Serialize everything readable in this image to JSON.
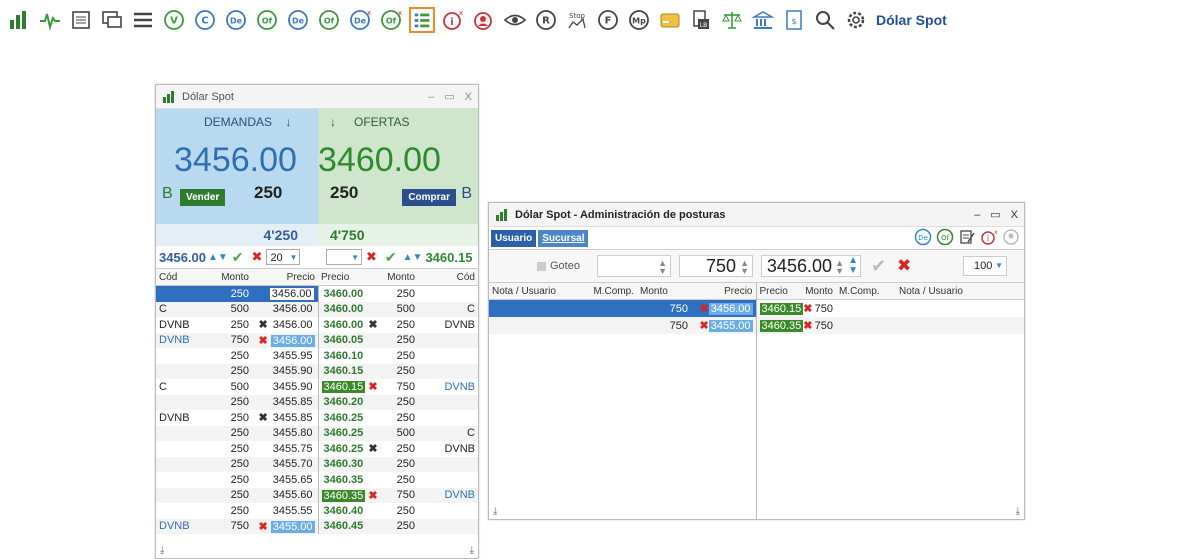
{
  "toolbar": {
    "title": "Dólar Spot",
    "icons": [
      "logo-icon",
      "chart-pulse-icon",
      "list-icon",
      "chat-icon",
      "menu-icon",
      "v-circle-icon",
      "c-circle-icon",
      "de-circle-icon",
      "of-circle-icon",
      "de-refresh-icon",
      "of-refresh-icon",
      "de-x-icon",
      "of-x-icon",
      "posturas-grid-icon",
      "info-x-icon",
      "users-x-icon",
      "eye-icon",
      "r-circle-icon",
      "stop-icon",
      "f-circle-icon",
      "mp-circle-icon",
      "card-icon",
      "lb-icon",
      "scale-icon",
      "bank-chart-icon",
      "document-icon",
      "search-icon",
      "gear-icon"
    ]
  },
  "book_window": {
    "title": "Dólar Spot",
    "demandas_label": "DEMANDAS",
    "ofertas_label": "OFERTAS",
    "best_bid": "3456.00",
    "best_ask": "3460.00",
    "bid_side_letter": "B",
    "ask_side_letter": "B",
    "vender_label": "Vender",
    "comprar_label": "Comprar",
    "bid_qty": "250",
    "ask_qty": "250",
    "bid_total": "4'250",
    "ask_total": "4'750",
    "bid_input_price": "3456.00",
    "bid_input_qty": "20",
    "ask_input_price": "3460.15",
    "columns": [
      "Cód",
      "Monto",
      "Precio",
      "Precio",
      "Monto",
      "Cód"
    ],
    "rows": [
      {
        "bcod": "",
        "bmonto": "250",
        "bprecio": "3456.00",
        "bx": "",
        "aprecio": "3460.00",
        "ax": "",
        "amonto": "250",
        "acod": ""
      },
      {
        "bcod": "C",
        "bmonto": "500",
        "bprecio": "3456.00",
        "bx": "",
        "aprecio": "3460.00",
        "ax": "",
        "amonto": "500",
        "acod": "C"
      },
      {
        "bcod": "DVNB",
        "bmonto": "250",
        "bprecio": "3456.00",
        "bx": "✖",
        "aprecio": "3460.00",
        "ax": "✖",
        "amonto": "250",
        "acod": "DVNB"
      },
      {
        "bcod": "DVNB",
        "bmonto": "750",
        "bprecio": "3456.00",
        "bx": "✖",
        "aprecio": "3460.05",
        "ax": "",
        "amonto": "250",
        "acod": ""
      },
      {
        "bcod": "",
        "bmonto": "250",
        "bprecio": "3455.95",
        "bx": "",
        "aprecio": "3460.10",
        "ax": "",
        "amonto": "250",
        "acod": ""
      },
      {
        "bcod": "",
        "bmonto": "250",
        "bprecio": "3455.90",
        "bx": "",
        "aprecio": "3460.15",
        "ax": "",
        "amonto": "250",
        "acod": ""
      },
      {
        "bcod": "C",
        "bmonto": "500",
        "bprecio": "3455.90",
        "bx": "",
        "aprecio": "3460.15",
        "ax": "✖",
        "amonto": "750",
        "acod": "DVNB"
      },
      {
        "bcod": "",
        "bmonto": "250",
        "bprecio": "3455.85",
        "bx": "",
        "aprecio": "3460.20",
        "ax": "",
        "amonto": "250",
        "acod": ""
      },
      {
        "bcod": "DVNB",
        "bmonto": "250",
        "bprecio": "3455.85",
        "bx": "✖",
        "aprecio": "3460.25",
        "ax": "",
        "amonto": "250",
        "acod": ""
      },
      {
        "bcod": "",
        "bmonto": "250",
        "bprecio": "3455.80",
        "bx": "",
        "aprecio": "3460.25",
        "ax": "",
        "amonto": "500",
        "acod": "C"
      },
      {
        "bcod": "",
        "bmonto": "250",
        "bprecio": "3455.75",
        "bx": "",
        "aprecio": "3460.25",
        "ax": "✖",
        "amonto": "250",
        "acod": "DVNB"
      },
      {
        "bcod": "",
        "bmonto": "250",
        "bprecio": "3455.70",
        "bx": "",
        "aprecio": "3460.30",
        "ax": "",
        "amonto": "250",
        "acod": ""
      },
      {
        "bcod": "",
        "bmonto": "250",
        "bprecio": "3455.65",
        "bx": "",
        "aprecio": "3460.35",
        "ax": "",
        "amonto": "250",
        "acod": ""
      },
      {
        "bcod": "",
        "bmonto": "250",
        "bprecio": "3455.60",
        "bx": "",
        "aprecio": "3460.35",
        "ax": "✖",
        "amonto": "750",
        "acod": "DVNB"
      },
      {
        "bcod": "",
        "bmonto": "250",
        "bprecio": "3455.55",
        "bx": "",
        "aprecio": "3460.40",
        "ax": "",
        "amonto": "250",
        "acod": ""
      },
      {
        "bcod": "DVNB",
        "bmonto": "750",
        "bprecio": "3455.00",
        "bx": "✖",
        "aprecio": "3460.45",
        "ax": "",
        "amonto": "250",
        "acod": ""
      }
    ]
  },
  "admin_window": {
    "title": "Dólar Spot - Administración de posturas",
    "tab_usuario": "Usuario",
    "tab_sucursal": "Sucursal",
    "goteo_label": "Goteo",
    "qty_value": "750",
    "price_value": "3456.00",
    "lot_value": "100",
    "columns": [
      "Nota / Usuario",
      "M.Comp.",
      "Monto",
      "Precio",
      "Precio",
      "Monto",
      "M.Comp.",
      "Nota / Usuario"
    ],
    "rows": [
      {
        "bmonto": "750",
        "bprecio": "3456.00",
        "aprecio": "3460.15",
        "amonto": "750"
      },
      {
        "bmonto": "750",
        "bprecio": "3455.00",
        "aprecio": "3460.35",
        "amonto": "750"
      }
    ]
  },
  "colors": {
    "accent": "#2e6fc0",
    "bid_bg": "#b9d9f0",
    "ask_bg": "#cfe6cd",
    "selected_tool_border": "#f28a1f",
    "green_price": "#3a8a2a",
    "red_x": "#dd2222"
  }
}
